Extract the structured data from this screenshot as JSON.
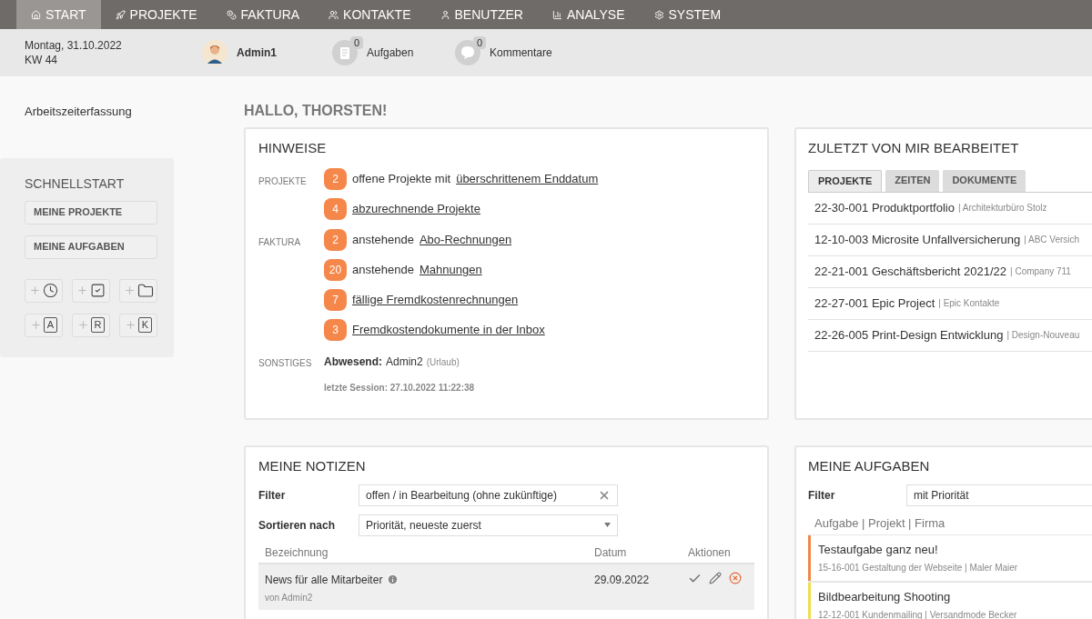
{
  "nav": [
    {
      "label": "START",
      "selected": true
    },
    {
      "label": "PROJEKTE",
      "selected": false
    },
    {
      "label": "FAKTURA",
      "selected": false
    },
    {
      "label": "KONTAKTE",
      "selected": false
    },
    {
      "label": "BENUTZER",
      "selected": false
    },
    {
      "label": "ANALYSE",
      "selected": false
    },
    {
      "label": "SYSTEM",
      "selected": false
    }
  ],
  "subheader": {
    "date": "Montag, 31.10.2022",
    "week": "KW 44",
    "user": "Admin1",
    "tasks_count": "0",
    "tasks_label": "Aufgaben",
    "comments_count": "0",
    "comments_label": "Kommentare"
  },
  "sidebar": {
    "link": "Arbeitszeiterfassung",
    "quickstart": {
      "title": "SCHNELLSTART",
      "buttons": [
        "MEINE PROJEKTE",
        "MEINE AUFGABEN"
      ],
      "quick": [
        {
          "kind": "clock"
        },
        {
          "kind": "check"
        },
        {
          "kind": "folder"
        },
        {
          "kind": "letter",
          "letter": "A"
        },
        {
          "kind": "letter",
          "letter": "R"
        },
        {
          "kind": "letter",
          "letter": "K"
        }
      ]
    }
  },
  "greeting": "HALLO, THORSTEN!",
  "hints": {
    "title": "HINWEISE",
    "groups": [
      {
        "label": "PROJEKTE",
        "items": [
          {
            "count": "2",
            "text": "offene Projekte mit",
            "link": "überschrittenem Enddatum"
          },
          {
            "count": "4",
            "link": "abzurechnende Projekte"
          }
        ]
      },
      {
        "label": "FAKTURA",
        "items": [
          {
            "count": "2",
            "text": "anstehende",
            "link": "Abo-Rechnungen"
          },
          {
            "count": "20",
            "text": "anstehende",
            "link": "Mahnungen"
          },
          {
            "count": "7",
            "link": "fällige Fremdkostenrechnungen"
          },
          {
            "count": "3",
            "link": "Fremdkostendokumente in der Inbox"
          }
        ]
      }
    ],
    "other_label": "SONSTIGES",
    "absent_label": "Abwesend:",
    "absent_name": "Admin2",
    "absent_reason": "(Urlaub)",
    "session": "letzte Session: 27.10.2022 11:22:38"
  },
  "recent": {
    "title": "ZULETZT VON MIR BEARBEITET",
    "tabs": [
      {
        "label": "PROJEKTE",
        "selected": true
      },
      {
        "label": "ZEITEN",
        "selected": false
      },
      {
        "label": "DOKUMENTE",
        "selected": false
      }
    ],
    "items": [
      {
        "name": "22-30-001 Produktportfolio",
        "company": "| Architekturbüro Stolz"
      },
      {
        "name": "12-10-003 Microsite Unfallversicherung",
        "company": "| ABC Versich"
      },
      {
        "name": "22-21-001 Geschäftsbericht 2021/22",
        "company": "| Company 711"
      },
      {
        "name": "22-27-001 Epic Project",
        "company": "| Epic Kontakte"
      },
      {
        "name": "22-26-005 Print-Design Entwicklung",
        "company": "| Design-Nouveau"
      }
    ]
  },
  "notes": {
    "title": "MEINE NOTIZEN",
    "filter_label": "Filter",
    "filter_value": "offen / in Bearbeitung (ohne zukünftige)",
    "sort_label": "Sortieren nach",
    "sort_value": "Priorität, neueste zuerst",
    "columns": [
      "Bezeichnung",
      "Datum",
      "Aktionen"
    ],
    "rows": [
      {
        "title": "News für alle Mitarbeiter",
        "author": "von Admin2",
        "date": "29.09.2022"
      }
    ]
  },
  "tasks": {
    "title": "MEINE AUFGABEN",
    "filter_label": "Filter",
    "filter_value": "mit Priorität",
    "header": "Aufgabe | Projekt | Firma",
    "items": [
      {
        "title": "Testaufgabe ganz neu!",
        "detail": "15-16-001 Gestaltung der Webseite | Maler Maier",
        "color": "#f0874a"
      },
      {
        "title": "Bildbearbeitung Shooting",
        "detail": "12-12-001 Kundenmailing | Versandmode Becker",
        "color": "#ecdf4f"
      }
    ]
  }
}
